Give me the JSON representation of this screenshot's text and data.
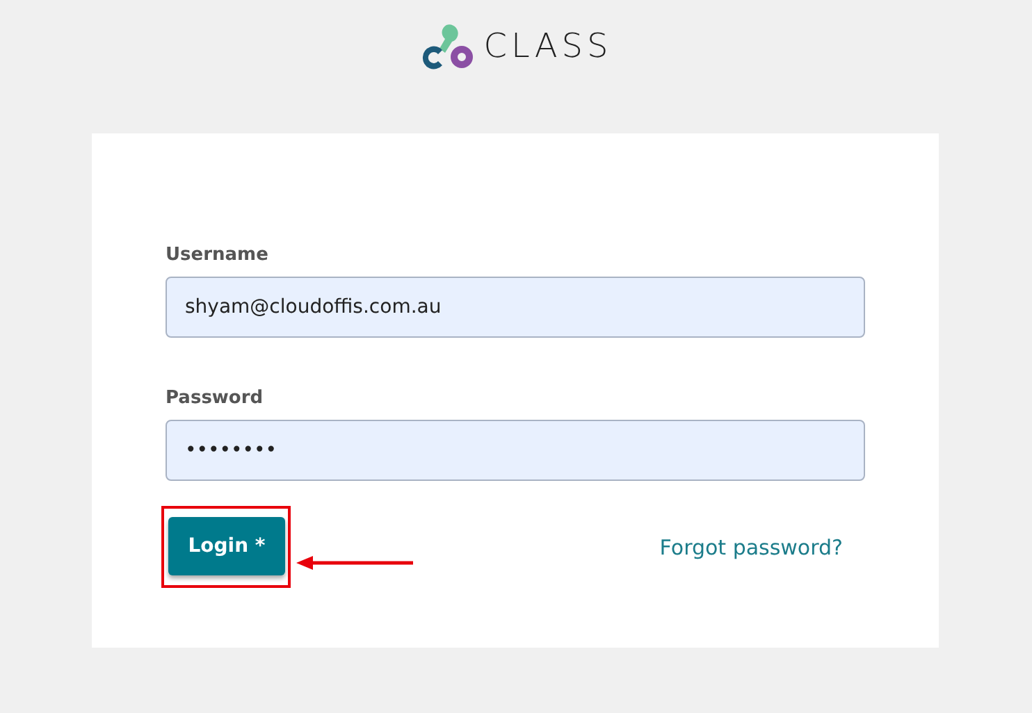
{
  "logo": {
    "text": "CLASS"
  },
  "fields": [
    {
      "label": "Username",
      "value": "shyam@cloudoffis.com.au"
    },
    {
      "label": "Password",
      "value": "••••••••"
    }
  ],
  "login_button": {
    "label": "Login *",
    "highlighted": true
  },
  "forgot_link": {
    "label": "Forgot password?"
  }
}
